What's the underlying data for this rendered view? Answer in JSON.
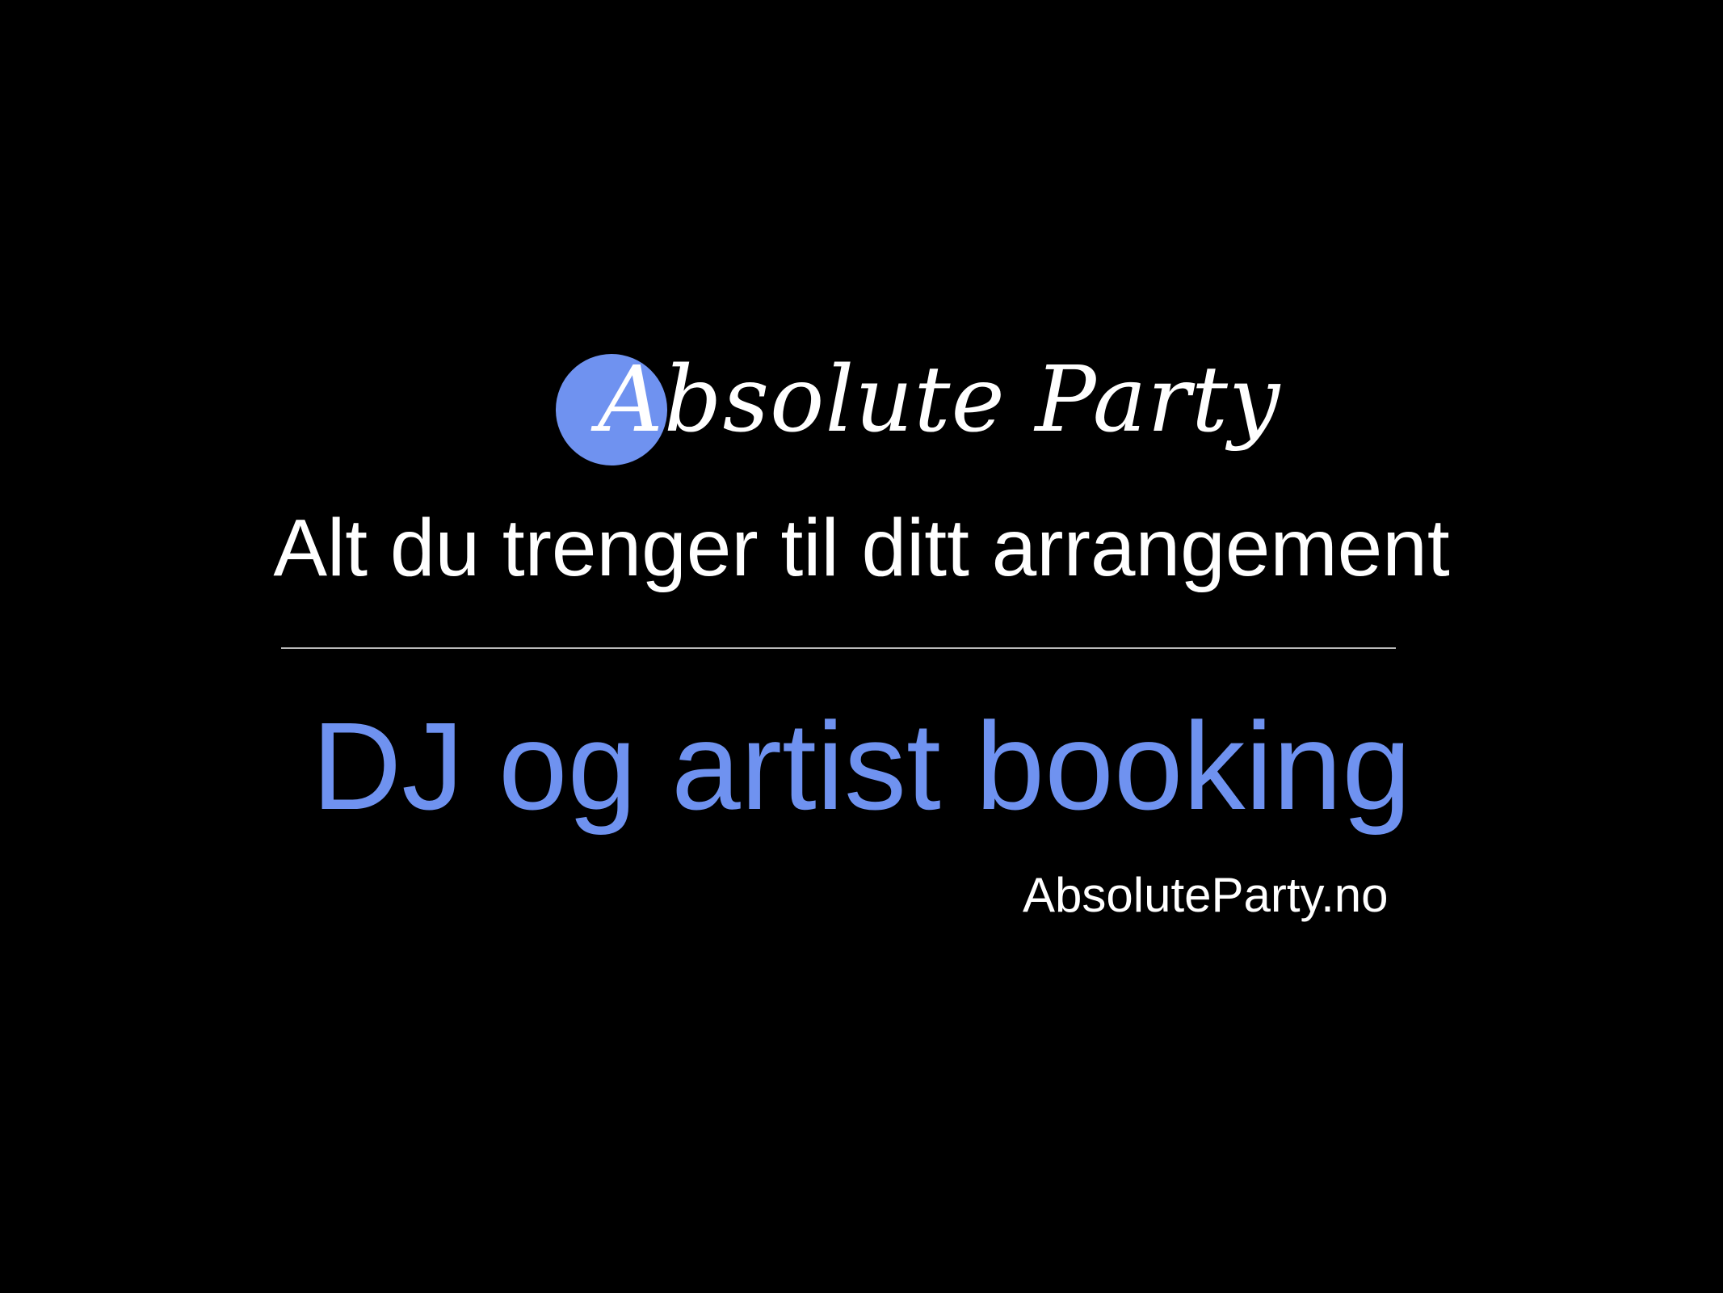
{
  "colors": {
    "background": "#000000",
    "accent": "#6f92f0",
    "text": "#ffffff",
    "divider": "#b9b9b9"
  },
  "logo": {
    "text": "Absolute Party",
    "icon": "blue-circle-icon"
  },
  "tagline": "Alt du trenger til ditt arrangement",
  "headline": "DJ og artist booking",
  "website": "AbsoluteParty.no"
}
